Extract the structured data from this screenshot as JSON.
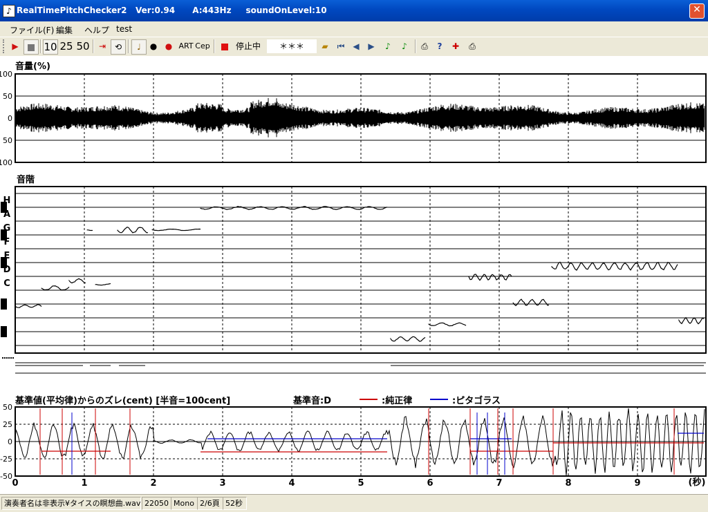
{
  "window": {
    "title": "RealTimePitchChecker2   Ver:0.94      A:443Hz     soundOnLevel:10",
    "close_label": "✕"
  },
  "menu": [
    "ファイル(F)",
    "編集",
    "ヘルプ",
    "test"
  ],
  "toolbar": {
    "speed_options": [
      "10",
      "25",
      "50"
    ],
    "art_label": "ART",
    "cep_label": "Cep",
    "status_label": "停止中",
    "note_display": "＊＊＊"
  },
  "volume_panel": {
    "label": "音量(%)",
    "y_ticks": [
      "100",
      "50",
      "0",
      "50",
      "100"
    ]
  },
  "scale_panel": {
    "label": "音階",
    "notes": [
      "H",
      "A",
      "G",
      "F",
      "E",
      "D",
      "C"
    ]
  },
  "deviation_panel": {
    "label": "基準値(平均律)からのズレ(cent) [半音=100cent]",
    "base_note_label": "基準音:D",
    "legend": [
      {
        "name": ":純正律",
        "color": "#cc0000"
      },
      {
        "name": ":ピタゴラス",
        "color": "#0000cc"
      }
    ],
    "y_ticks": [
      "50",
      "25",
      "0",
      "-25",
      "-50"
    ],
    "x_ticks": [
      "0",
      "1",
      "2",
      "3",
      "4",
      "5",
      "6",
      "7",
      "8",
      "9"
    ],
    "x_unit": "(秒)"
  },
  "colors": {
    "titlebar": "#0050c8",
    "just": "#cc0000",
    "pythagorean": "#0000cc"
  },
  "status": {
    "file": "演奏者名は非表示¥タイスの瞑想曲.wav",
    "rate": "22050",
    "channels": "Mono",
    "page": "2/6頁",
    "duration": "52秒"
  }
}
